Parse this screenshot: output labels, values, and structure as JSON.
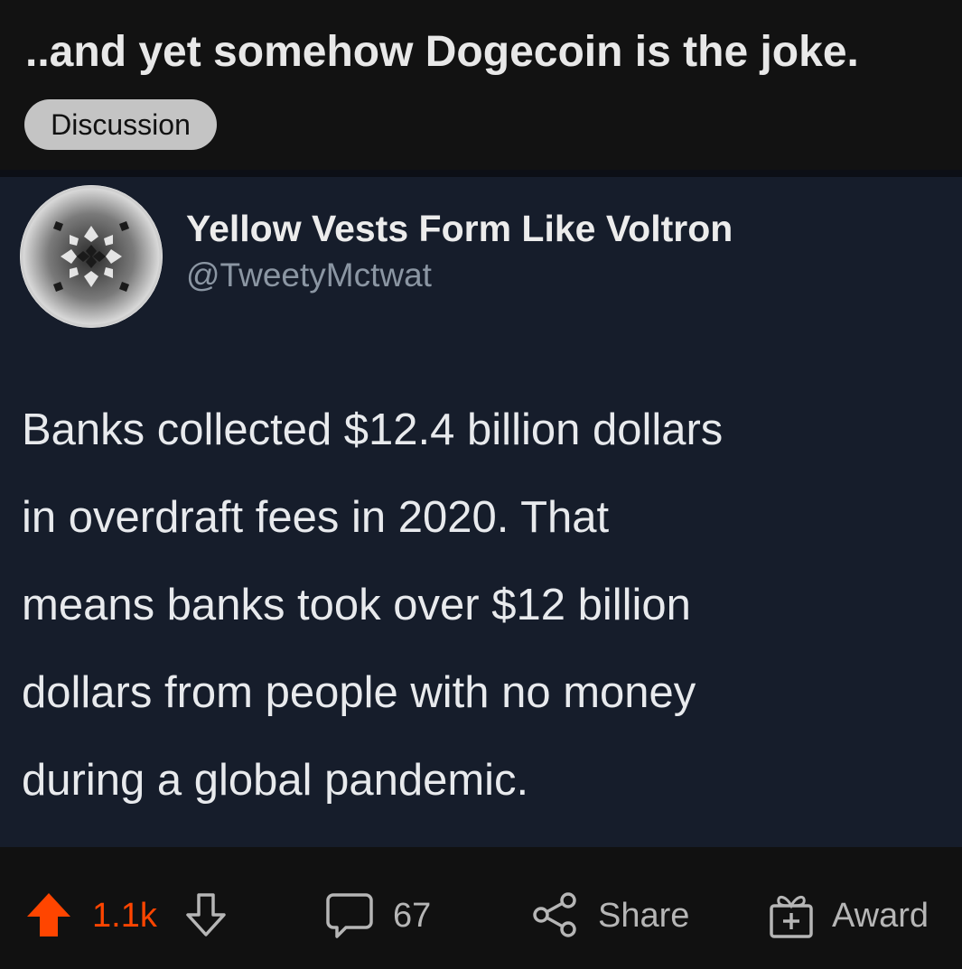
{
  "post": {
    "title": "..and yet somehow Dogecoin is the joke.",
    "flair": "Discussion"
  },
  "tweet": {
    "display_name": "Yellow Vests Form Like Voltron",
    "handle": "@TweetyMctwat",
    "avatar_icon": "escher-butterfly-avatar-icon",
    "body_lines": [
      "Banks collected $12.4 billion dollars",
      "in overdraft fees in 2020. That",
      "means banks took over $12 billion",
      "dollars from people with no money",
      "during a global pandemic."
    ]
  },
  "actions": {
    "score": "1.1k",
    "comment_count": "67",
    "share_label": "Share",
    "award_label": "Award",
    "icons": [
      "upvote-icon",
      "downvote-icon",
      "comment-icon",
      "share-icon",
      "award-icon"
    ]
  },
  "colors": {
    "background": "#111111",
    "tweet_background": "#161d2b",
    "upvote_accent": "#ff4500",
    "flair_background": "#c4c4c4",
    "muted_text": "#b6b6b6"
  }
}
